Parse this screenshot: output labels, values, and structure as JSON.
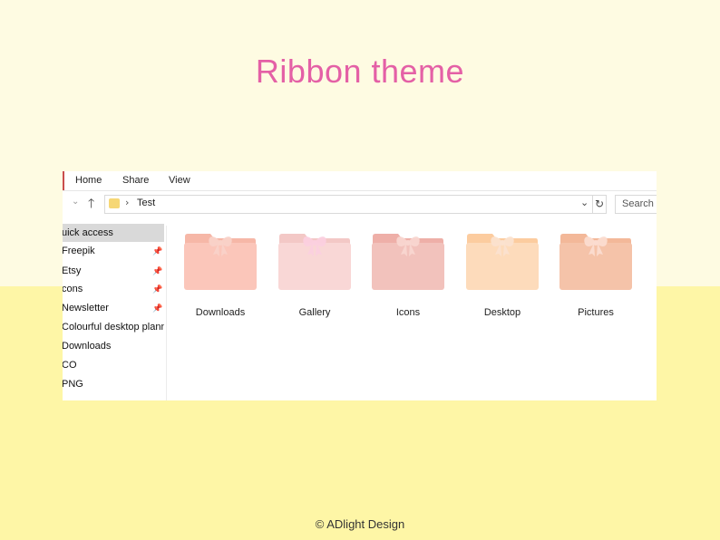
{
  "page": {
    "title": "Ribbon theme",
    "footer": "© ADlight Design"
  },
  "explorer": {
    "tabs": [
      "Home",
      "Share",
      "View"
    ],
    "address": {
      "path": "Test",
      "separator": "›"
    },
    "search": {
      "placeholder": "Search T"
    },
    "sidebar": [
      {
        "label": "uick access",
        "pinned": false,
        "selected": true
      },
      {
        "label": "Freepik",
        "pinned": true
      },
      {
        "label": "Etsy",
        "pinned": true
      },
      {
        "label": "cons",
        "pinned": true
      },
      {
        "label": "Newsletter",
        "pinned": true
      },
      {
        "label": "Colourful desktop plann",
        "pinned": false
      },
      {
        "label": "Downloads",
        "pinned": false
      },
      {
        "label": "CO",
        "pinned": false
      },
      {
        "label": "PNG",
        "pinned": false
      }
    ],
    "folders": [
      {
        "label": "Downloads",
        "back": "#f6b7a7",
        "front": "#fbc6ba",
        "bow": "#f9d2c8"
      },
      {
        "label": "Gallery",
        "back": "#f3c8c6",
        "front": "#f9d7d6",
        "bow": "#fbd0df"
      },
      {
        "label": "Icons",
        "back": "#eeafa8",
        "front": "#f2c2bc",
        "bow": "#f8d6d0"
      },
      {
        "label": "Desktop",
        "back": "#fccc9f",
        "front": "#fddbbb",
        "bow": "#fbe2cf"
      },
      {
        "label": "Pictures",
        "back": "#f3b899",
        "front": "#f5c3a9",
        "bow": "#fbdcd0"
      }
    ]
  },
  "colors": {
    "title": "#e460a6",
    "background_top": "#fefbe2",
    "background_bottom": "#fef6a6"
  }
}
